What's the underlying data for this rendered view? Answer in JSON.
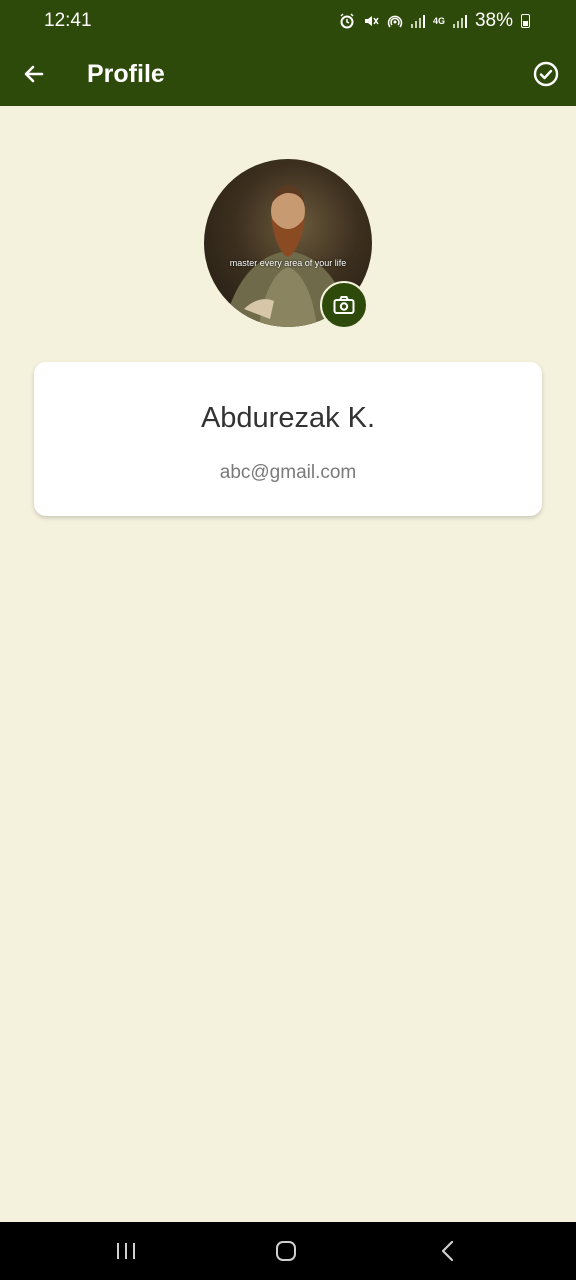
{
  "status_bar": {
    "time": "12:41",
    "network": "4G",
    "battery": "38%"
  },
  "app_bar": {
    "title": "Profile",
    "back_icon": "arrow-left-icon",
    "confirm_icon": "check-circle-icon"
  },
  "avatar": {
    "caption": "master every area of your life",
    "camera_icon": "camera-icon"
  },
  "profile": {
    "name": "Abdurezak K.",
    "email": "abc@gmail.com"
  },
  "nav_bar": {
    "recents_icon": "recents-icon",
    "home_icon": "home-icon",
    "back_icon": "back-chevron-icon"
  },
  "colors": {
    "primary": "#2e4a0a",
    "background": "#f4f2dc",
    "card": "#ffffff"
  }
}
